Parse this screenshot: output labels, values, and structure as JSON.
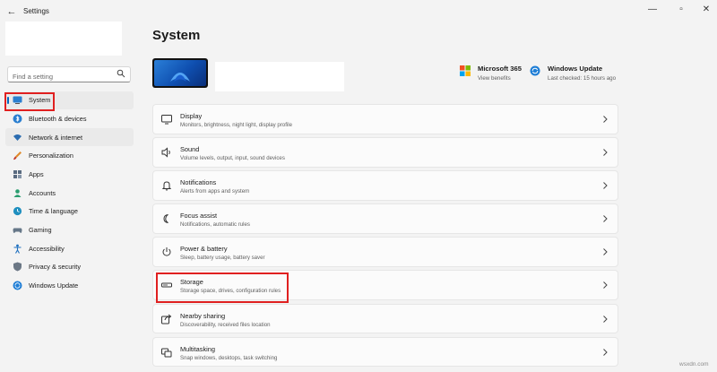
{
  "app": {
    "title": "Settings",
    "back_glyph": "←",
    "minimize_glyph": "—",
    "maximize_glyph": "▫",
    "close_glyph": "✕"
  },
  "search": {
    "placeholder": "Find a setting"
  },
  "sidebar": {
    "items": [
      {
        "label": "System",
        "icon": "system-monitor-icon",
        "selected": true
      },
      {
        "label": "Bluetooth & devices",
        "icon": "bluetooth-icon"
      },
      {
        "label": "Network & internet",
        "icon": "wifi-icon"
      },
      {
        "label": "Personalization",
        "icon": "brush-icon"
      },
      {
        "label": "Apps",
        "icon": "apps-icon"
      },
      {
        "label": "Accounts",
        "icon": "person-icon"
      },
      {
        "label": "Time & language",
        "icon": "globe-clock-icon"
      },
      {
        "label": "Gaming",
        "icon": "gamepad-icon"
      },
      {
        "label": "Accessibility",
        "icon": "accessibility-icon"
      },
      {
        "label": "Privacy & security",
        "icon": "shield-icon"
      },
      {
        "label": "Windows Update",
        "icon": "windows-update-icon"
      }
    ]
  },
  "main": {
    "title": "System",
    "promos": [
      {
        "title": "Microsoft 365",
        "subtitle": "View benefits",
        "icon": "microsoft-logo-icon"
      },
      {
        "title": "Windows Update",
        "subtitle": "Last checked: 15 hours ago",
        "icon": "sync-icon"
      }
    ],
    "settings": [
      {
        "title": "Display",
        "subtitle": "Monitors, brightness, night light, display profile",
        "icon": "display-icon"
      },
      {
        "title": "Sound",
        "subtitle": "Volume levels, output, input, sound devices",
        "icon": "speaker-icon"
      },
      {
        "title": "Notifications",
        "subtitle": "Alerts from apps and system",
        "icon": "bell-icon"
      },
      {
        "title": "Focus assist",
        "subtitle": "Notifications, automatic rules",
        "icon": "moon-icon"
      },
      {
        "title": "Power & battery",
        "subtitle": "Sleep, battery usage, battery saver",
        "icon": "power-icon"
      },
      {
        "title": "Storage",
        "subtitle": "Storage space, drives, configuration rules",
        "icon": "storage-drive-icon",
        "highlighted": true
      },
      {
        "title": "Nearby sharing",
        "subtitle": "Discoverability, received files location",
        "icon": "share-icon"
      },
      {
        "title": "Multitasking",
        "subtitle": "Snap windows, desktops, task switching",
        "icon": "multitasking-icon"
      }
    ]
  },
  "colors": {
    "accent": "#0067c0",
    "highlight_box": "#e02020",
    "background": "#f3f3f3",
    "card": "#fbfbfb"
  },
  "watermark": "wsxdn.com"
}
